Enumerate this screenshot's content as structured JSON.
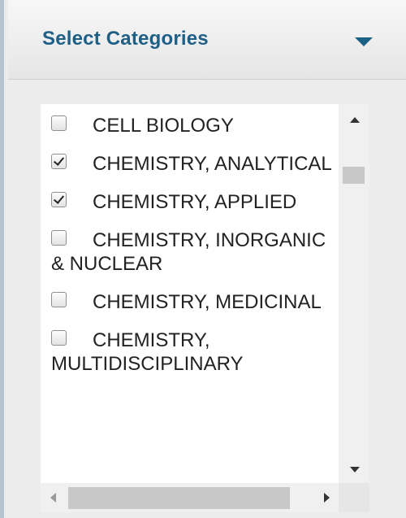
{
  "panel": {
    "title": "Select Categories",
    "toggle_icon": "caret-down-icon",
    "accent_color": "#1e5f86"
  },
  "categories": [
    {
      "label": "CELL BIOLOGY",
      "checked": false
    },
    {
      "label": "CHEMISTRY, ANALYTICAL",
      "checked": true
    },
    {
      "label": "CHEMISTRY, APPLIED",
      "checked": true
    },
    {
      "label": "CHEMISTRY, INORGANIC & NUCLEAR",
      "checked": false
    },
    {
      "label": "CHEMISTRY, MEDICINAL",
      "checked": false
    },
    {
      "label": "CHEMISTRY, MULTIDISCIPLINARY",
      "checked": false
    }
  ]
}
